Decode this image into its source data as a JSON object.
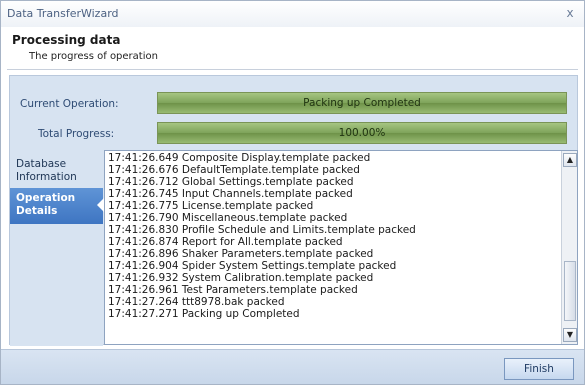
{
  "window": {
    "title": "Data TransferWizard",
    "close_glyph": "x"
  },
  "header": {
    "title": "Processing data",
    "subtitle": "The progress of operation"
  },
  "progress": {
    "current_operation": {
      "label": "Current Operation:",
      "status": "Packing up Completed",
      "fraction": 1.0
    },
    "total_progress": {
      "label": "Total Progress:",
      "status": "100.00%",
      "fraction": 1.0
    }
  },
  "sidebar": {
    "items": [
      {
        "label_line1": "Database",
        "label_line2": "Information",
        "active": false
      },
      {
        "label_line1": "Operation",
        "label_line2": "Details",
        "active": true
      }
    ]
  },
  "log": {
    "lines": [
      "17:41:26.649 Composite Display.template packed",
      "17:41:26.676 DefaultTemplate.template packed",
      "17:41:26.712 Global Settings.template packed",
      "17:41:26.745 Input Channels.template packed",
      "17:41:26.775 License.template packed",
      "17:41:26.790 Miscellaneous.template packed",
      "17:41:26.830 Profile Schedule and Limits.template packed",
      "17:41:26.874 Report for All.template packed",
      "17:41:26.896 Shaker Parameters.template packed",
      "17:41:26.904 Spider System Settings.template packed",
      "17:41:26.932 System Calibration.template packed",
      "17:41:26.961 Test Parameters.template packed",
      "17:41:27.264 ttt8978.bak packed",
      "17:41:27.271 Packing up Completed"
    ]
  },
  "footer": {
    "finish_label": "Finish"
  },
  "colors": {
    "accent": "#3e75c2",
    "progress_green": "#7ea35a",
    "panel_bg": "#d7e3f1"
  }
}
